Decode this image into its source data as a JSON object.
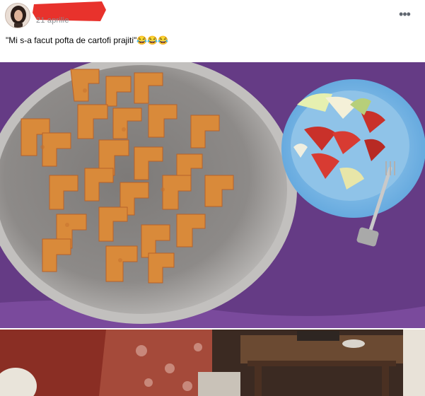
{
  "post": {
    "date": "21 aprilie",
    "caption": "\"Mi s-a facut pofta de cartofi prajiti\"",
    "caption_emojis": "😂😂😂",
    "more_label": "•••"
  },
  "colors": {
    "tablecloth": "#6b3f8c",
    "bowl_metal": "#9a9a9a",
    "fries": "#d98a3a",
    "salad_bowl": "#79b6e3",
    "tomato": "#c9312a",
    "redaction": "#e8322c"
  },
  "icons": {
    "more": "more-horizontal-icon",
    "avatar": "profile-avatar"
  }
}
